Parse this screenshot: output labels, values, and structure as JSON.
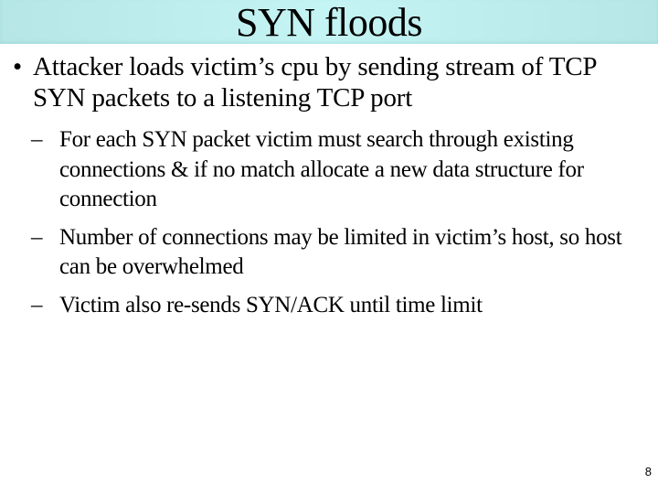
{
  "slide": {
    "title": "SYN floods",
    "colors": {
      "title_bar": "#bfeeee",
      "text": "#000000",
      "background": "#ffffff"
    },
    "bullets": [
      {
        "marker": "•",
        "text": "Attacker loads victim’s cpu by sending stream of TCP SYN packets to a listening TCP port",
        "sub_bullets": [
          {
            "marker": "–",
            "text": "For each SYN packet victim must search through existing connections & if no match allocate a new data structure for connection"
          },
          {
            "marker": "–",
            "text": "Number of connections may be limited in victim’s host, so host can be overwhelmed"
          },
          {
            "marker": "–",
            "text": "Victim also re-sends SYN/ACK until time limit"
          }
        ]
      }
    ],
    "page_number": "8"
  }
}
